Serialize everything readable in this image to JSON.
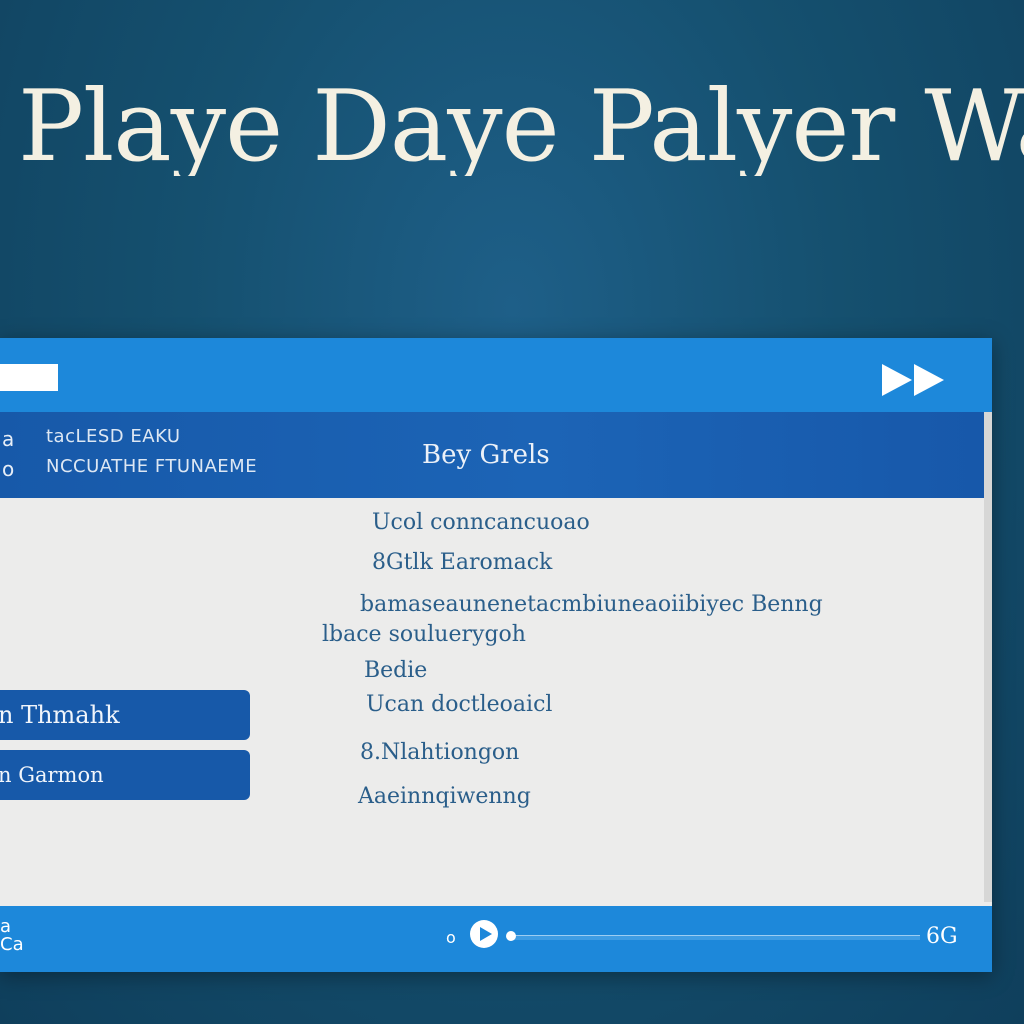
{
  "hero": {
    "title": "Playe Daye Palyer Wah Play"
  },
  "window": {
    "titlebar": {
      "field_value": ""
    },
    "header": {
      "left_glyphs": [
        "a",
        "o"
      ],
      "meta_line1": "tacLESD EAKU",
      "meta_line2": "NCCUATHE FTUNAEME",
      "title": "Bey Grels"
    },
    "content_lines": [
      "Ucol conncancuoao",
      "8Gtlk Earomack",
      "bamaseaunenetacmbiuneaoiibiyec Benng",
      "lbace souluerygoh",
      "Bedie",
      "Ucan doctleoaicl",
      "8.Nlahtiongon",
      "Aaeinnqiwenng"
    ],
    "side_buttons": [
      {
        "label": "n Thmahk"
      },
      {
        "label": "n Garmon"
      }
    ],
    "bottom_bar": {
      "left_glyphs": [
        "a",
        "Ca"
      ],
      "volume_glyph": "o",
      "time": "6G",
      "progress": 0.0
    }
  },
  "colors": {
    "background": "#15506f",
    "titlebar": "#1d88da",
    "header_band": "#1759a9",
    "content_bg": "#ececeb",
    "content_text": "#2a5e8a",
    "hero_text": "#f4f0e2"
  },
  "icons": {
    "next": "fast-forward-icon",
    "play": "play-icon",
    "volume": "volume-icon"
  }
}
